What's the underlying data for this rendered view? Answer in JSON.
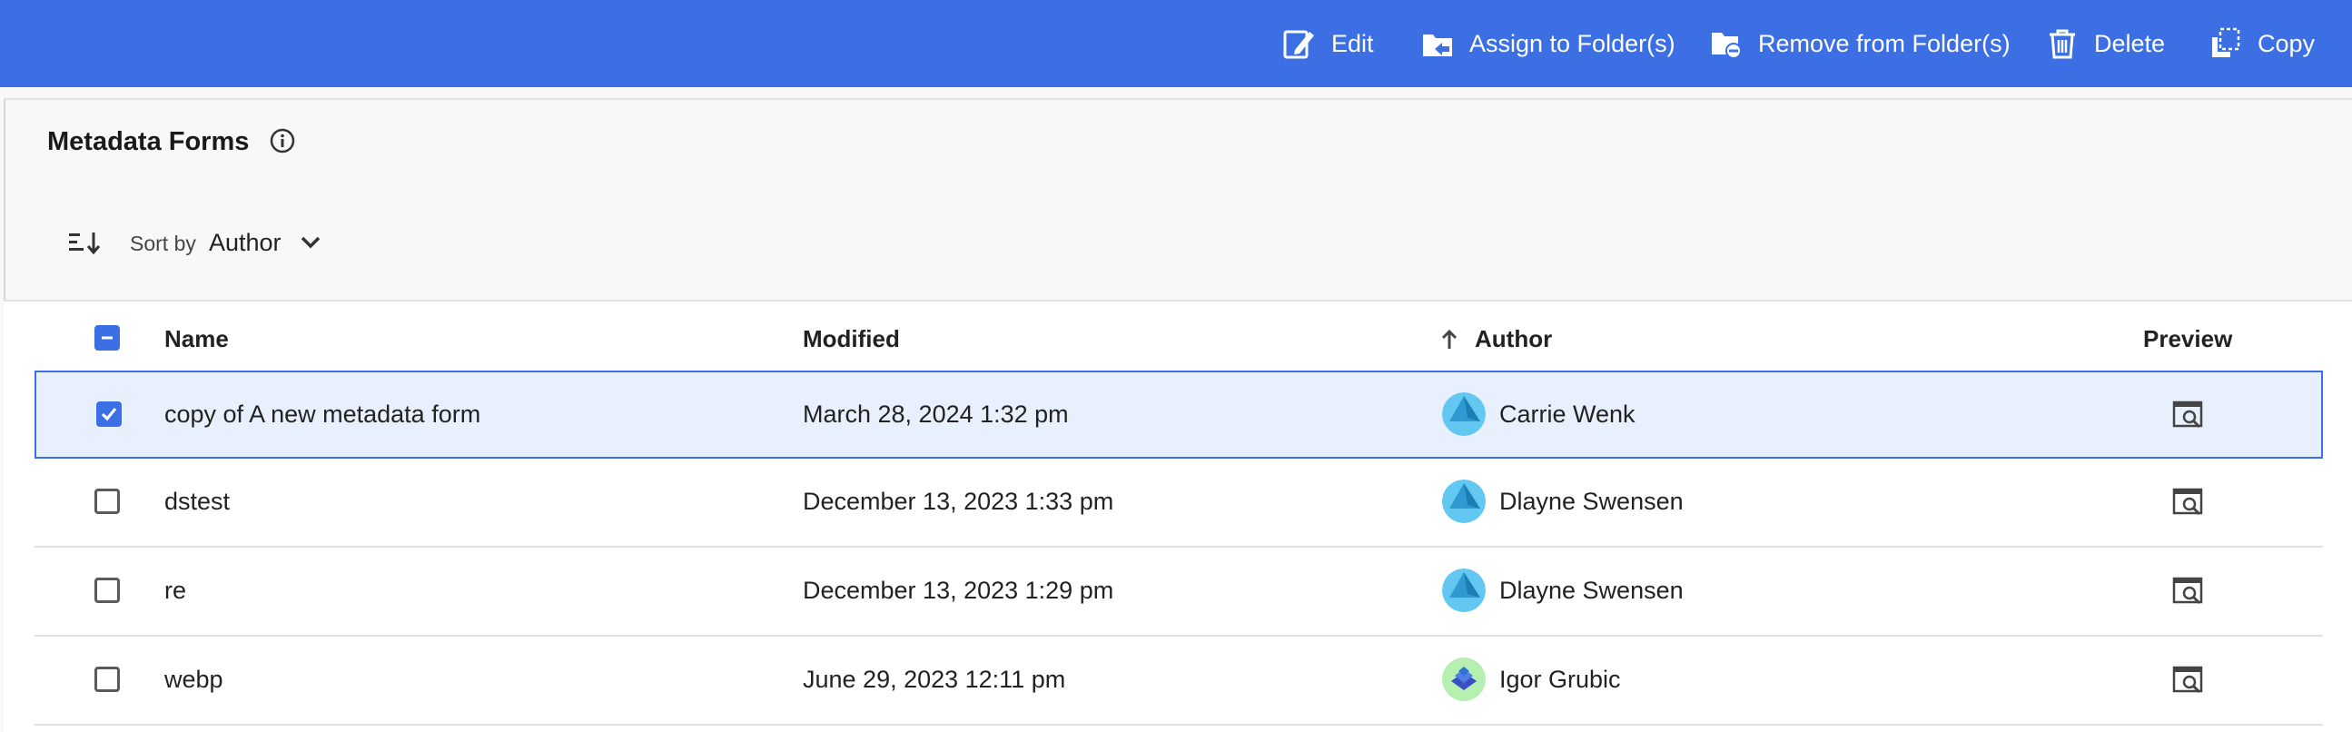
{
  "toolbar": {
    "actions": [
      {
        "label": "Edit",
        "icon": "edit-icon"
      },
      {
        "label": "Assign to Folder(s)",
        "icon": "folder-assign-icon"
      },
      {
        "label": "Remove from Folder(s)",
        "icon": "folder-remove-icon"
      },
      {
        "label": "Delete",
        "icon": "trash-icon"
      },
      {
        "label": "Copy",
        "icon": "copy-icon"
      }
    ],
    "color": "#3b6fe3"
  },
  "page": {
    "title": "Metadata Forms",
    "info_icon": "info-icon"
  },
  "sort": {
    "label": "Sort by",
    "value": "Author",
    "icon": "sort-icon"
  },
  "table": {
    "columns": {
      "name": "Name",
      "modified": "Modified",
      "author": "Author",
      "preview": "Preview"
    },
    "sorted_column": "Author",
    "sort_direction": "ascending",
    "header_select": "partial",
    "rows": [
      {
        "name": "copy of A new metadata form",
        "modified": "March 28, 2024 1:32 pm",
        "author": "Carrie Wenk",
        "checked": true
      },
      {
        "name": "dstest",
        "modified": "December 13, 2023 1:33 pm",
        "author": "Dlayne Swensen",
        "checked": false
      },
      {
        "name": "re",
        "modified": "December 13, 2023 1:29 pm",
        "author": "Dlayne Swensen",
        "checked": false
      },
      {
        "name": "webp",
        "modified": "June 29, 2023 12:11 pm",
        "author": "Igor Grubic",
        "checked": false
      }
    ]
  }
}
